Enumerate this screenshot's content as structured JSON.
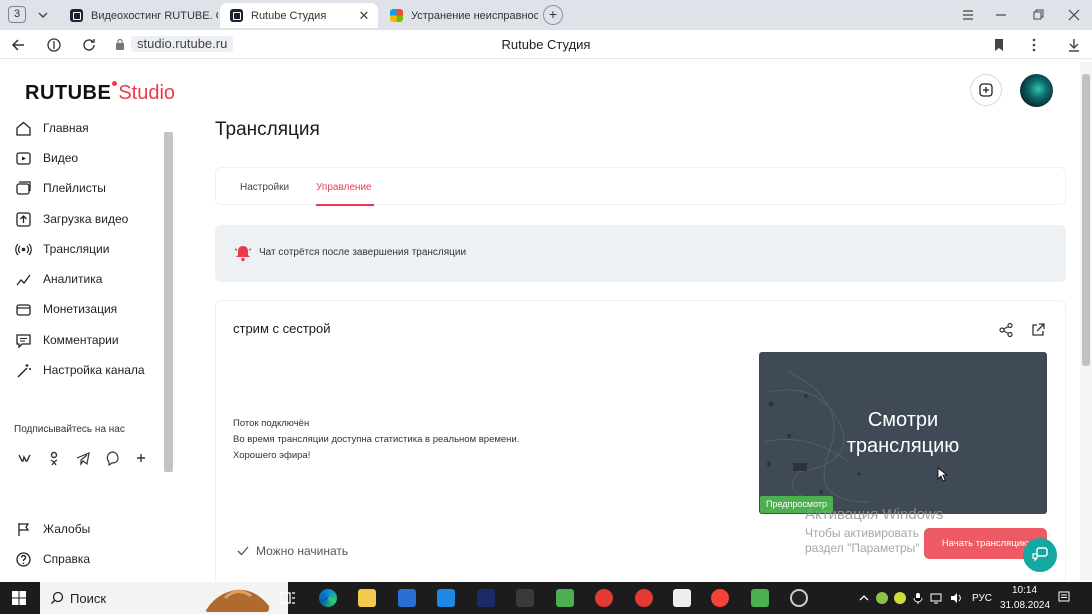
{
  "browser": {
    "tab_count": "3",
    "tabs": [
      {
        "label": "Видеохостинг RUTUBE. С",
        "favicon": "rutube-icon"
      },
      {
        "label": "Rutube Студия",
        "favicon": "rutube-icon",
        "close": "✕"
      },
      {
        "label": "Устранение неисправнос",
        "favicon": "microsoft-icon"
      }
    ],
    "new_tab": "+",
    "url": "studio.rutube.ru",
    "page_title": "Rutube Студия"
  },
  "app": {
    "logo_main": "RUTUBE",
    "logo_sub": "Studio",
    "accent_color": "#ed3a4a"
  },
  "sidebar": {
    "items": [
      {
        "label": "Главная",
        "icon": "home-icon"
      },
      {
        "label": "Видео",
        "icon": "video-icon"
      },
      {
        "label": "Плейлисты",
        "icon": "playlist-icon"
      },
      {
        "label": "Загрузка видео",
        "icon": "upload-icon"
      },
      {
        "label": "Трансляции",
        "icon": "broadcast-icon"
      },
      {
        "label": "Аналитика",
        "icon": "analytics-icon"
      },
      {
        "label": "Монетизация",
        "icon": "monetization-icon"
      },
      {
        "label": "Комментарии",
        "icon": "comments-icon"
      },
      {
        "label": "Настройка канала",
        "icon": "magic-wand-icon"
      }
    ],
    "social_title": "Подписывайтесь на нас",
    "social": [
      "ВК",
      "ОК",
      "Telegram",
      "Viber",
      "+"
    ],
    "bottom_items": [
      {
        "label": "Жалобы",
        "icon": "complaint-icon"
      },
      {
        "label": "Справка",
        "icon": "help-icon"
      }
    ]
  },
  "main": {
    "title": "Трансляция",
    "tabs": [
      {
        "label": "Настройки",
        "active": false
      },
      {
        "label": "Управление",
        "active": true
      }
    ],
    "alert": "Чат сотрётся после завершения трансляции",
    "stream": {
      "title": "стрим с сестрой",
      "status": [
        "Поток подключён",
        "Во время трансляции доступна статистика в реальном времени.",
        "Хорошего эфира!"
      ],
      "ready": "Можно начинать",
      "preview_text": [
        "Смотри",
        "трансляцию"
      ],
      "preview_badge": "Предпросмотр",
      "start_button": "Начать трансляцию"
    }
  },
  "watermark": {
    "line1": "Активация Windows",
    "line2": "Чтобы активировать",
    "line3": "раздел \"Параметры\""
  },
  "taskbar": {
    "search_label": "Поиск",
    "language": "РУС",
    "time": "10:14",
    "date": "31.08.2024"
  }
}
